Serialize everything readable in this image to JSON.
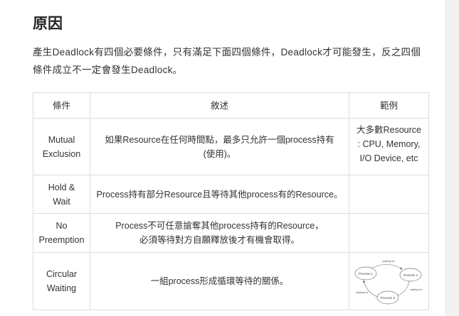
{
  "section": {
    "title": "原因",
    "intro": "產生Deadlock有四個必要條件，只有滿足下面四個條件，Deadlock才可能發生，反之四個條件成立不一定會發生Deadlock。"
  },
  "table": {
    "headers": [
      "條件",
      "敘述",
      "範例"
    ],
    "rows": [
      {
        "condition": [
          "Mutual",
          "Exclusion"
        ],
        "description": [
          "如果Resource在任何時間點，最多只允許一個process持有",
          "(使用)。"
        ],
        "example": [
          "大多數Resource",
          ": CPU, Memory,",
          "I/O Device, etc"
        ]
      },
      {
        "condition": [
          "Hold &",
          "Wait"
        ],
        "description": [
          "Process持有部分Resource且等待其他process有的Resource。"
        ],
        "example": []
      },
      {
        "condition": [
          "No",
          "Preemption"
        ],
        "description": [
          "Process不可任意搶奪其他process持有的Resource，",
          "必須等待對方自願釋放後才有機會取得。"
        ],
        "example": []
      },
      {
        "condition": [
          "Circular",
          "Waiting"
        ],
        "description": [
          "一組process形成循環等待的關係。"
        ],
        "example_diagram": {
          "nodes": [
            "Process 1",
            "Process 2",
            "Process 3"
          ],
          "edge_labels": [
            "waiting for",
            "waiting for",
            "waiting for"
          ]
        }
      }
    ]
  }
}
